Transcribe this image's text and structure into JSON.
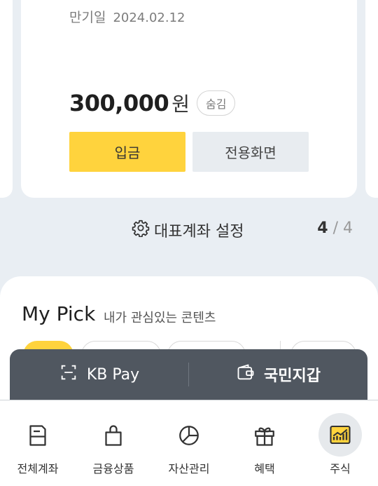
{
  "account": {
    "due_label": "만기일",
    "due_date": "2024.02.12",
    "amount": "300,000",
    "currency": "원",
    "hide_label": "숨김",
    "deposit_label": "입금",
    "dedicated_label": "전용화면"
  },
  "settings": {
    "label": "대표계좌 설정",
    "icon": "gear-icon",
    "page_current": "4",
    "page_sep": "/",
    "page_total": "4"
  },
  "pick": {
    "title": "My Pick",
    "subtitle": "내가 관심있는 콘텐츠"
  },
  "floatbar": {
    "kbpay_label": "KB Pay",
    "wallet_label": "국민지갑"
  },
  "nav": {
    "items": [
      {
        "label": "전체계좌",
        "icon": "account-list-icon"
      },
      {
        "label": "금융상품",
        "icon": "shopping-bag-icon"
      },
      {
        "label": "자산관리",
        "icon": "pie-chart-icon"
      },
      {
        "label": "혜택",
        "icon": "gift-icon"
      },
      {
        "label": "주식",
        "icon": "stock-chart-icon",
        "active": true
      }
    ]
  },
  "colors": {
    "accent": "#ffd33d",
    "floatbar": "#505760",
    "background": "#e9eef3"
  }
}
